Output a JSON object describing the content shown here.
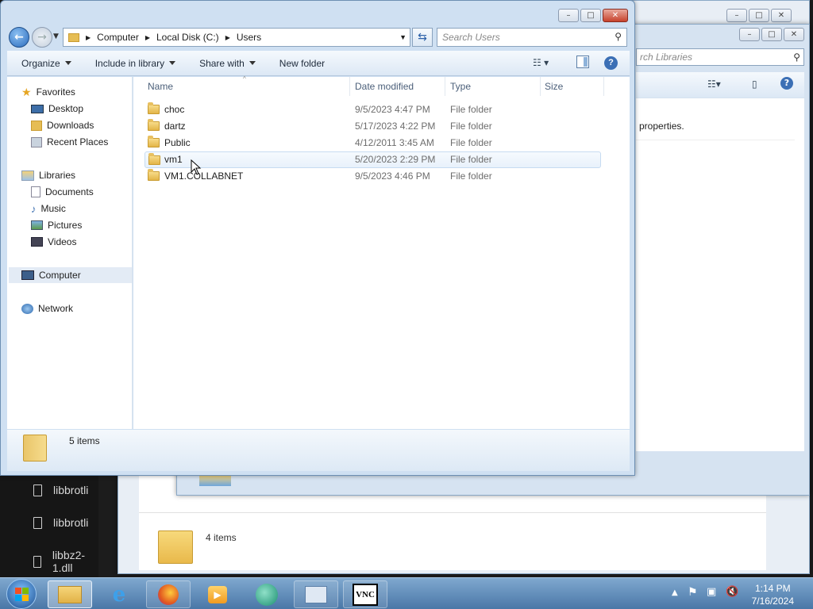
{
  "main": {
    "breadcrumb": [
      "Computer",
      "Local Disk (C:)",
      "Users"
    ],
    "search_placeholder": "Search Users",
    "toolbar": {
      "organize": "Organize",
      "include": "Include in library",
      "share": "Share with",
      "newfolder": "New folder"
    },
    "nav": {
      "favorites": "Favorites",
      "desktop": "Desktop",
      "downloads": "Downloads",
      "recent": "Recent Places",
      "libraries": "Libraries",
      "documents": "Documents",
      "music": "Music",
      "pictures": "Pictures",
      "videos": "Videos",
      "computer": "Computer",
      "network": "Network"
    },
    "columns": {
      "name": "Name",
      "date": "Date modified",
      "type": "Type",
      "size": "Size"
    },
    "rows": [
      {
        "name": "choc",
        "date": "9/5/2023 4:47 PM",
        "type": "File folder"
      },
      {
        "name": "dartz",
        "date": "5/17/2023 4:22 PM",
        "type": "File folder"
      },
      {
        "name": "Public",
        "date": "4/12/2011 3:45 AM",
        "type": "File folder"
      },
      {
        "name": "vm1",
        "date": "5/20/2023 2:29 PM",
        "type": "File folder"
      },
      {
        "name": "VM1.COLLABNET",
        "date": "9/5/2023 4:46 PM",
        "type": "File folder"
      }
    ],
    "status": "5 items"
  },
  "back": {
    "search_placeholder": "rch Libraries",
    "properties_text": "properties.",
    "status": "4 items"
  },
  "bg_list": [
    "libbrotli",
    "libbrotli",
    "libbz2-1.dll"
  ],
  "clock": {
    "time": "1:14 PM",
    "date": "7/16/2024"
  }
}
